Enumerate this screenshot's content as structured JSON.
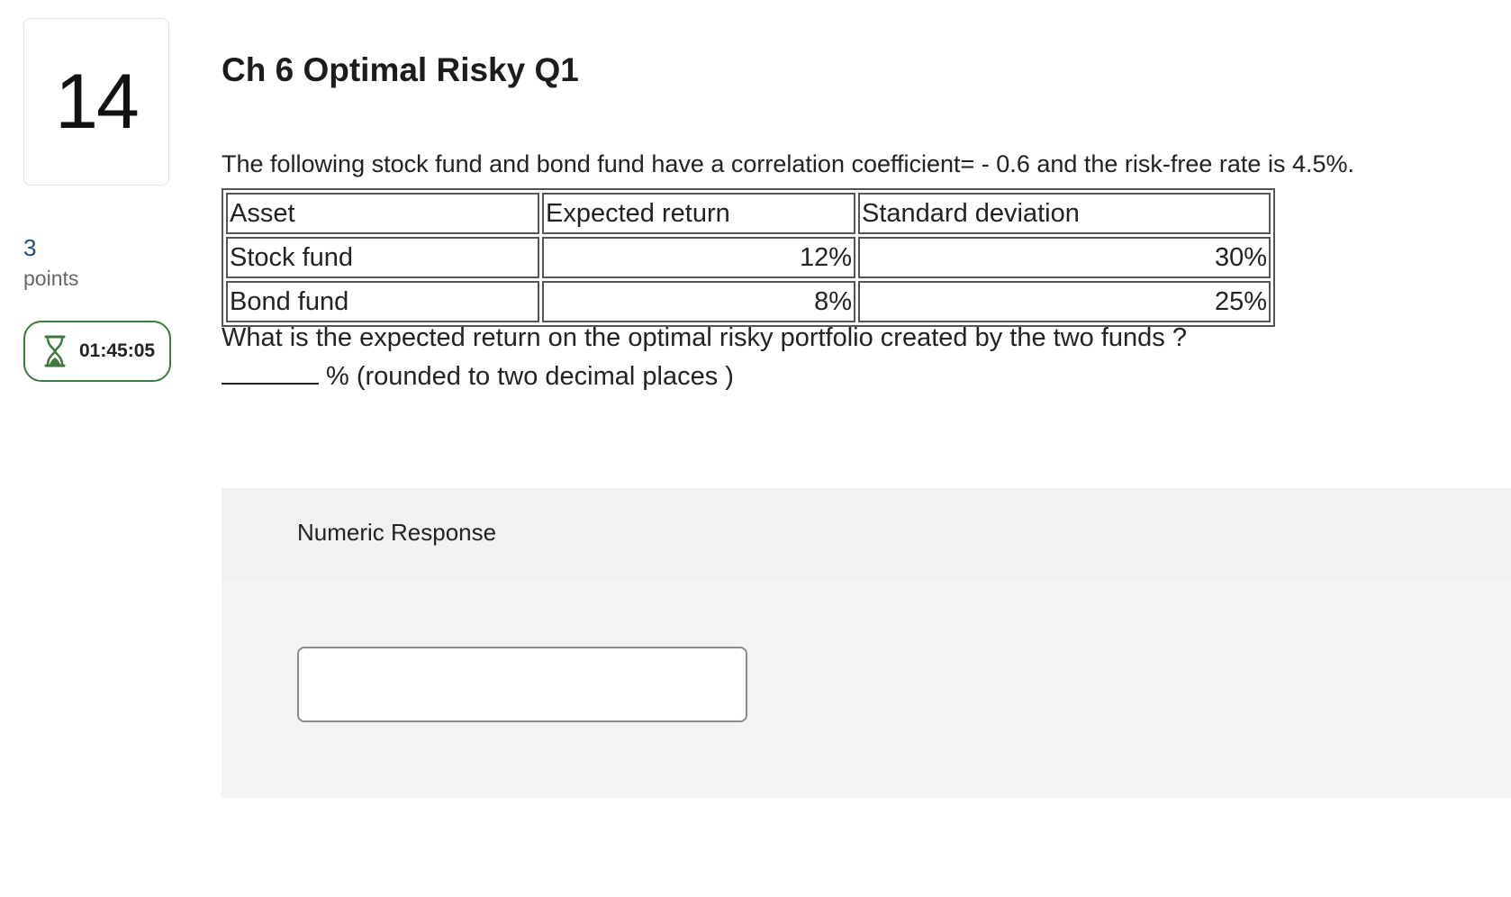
{
  "question": {
    "number": "14",
    "points_value": "3",
    "points_label": "points",
    "timer": "01:45:05",
    "title": "Ch 6 Optimal Risky Q1",
    "intro": "The following stock fund and bond fund have a correlation coefficient= - 0.6  and the risk-free rate is 4.5%.",
    "table": {
      "headers": [
        "Asset",
        "Expected return",
        "Standard deviation"
      ],
      "rows": [
        [
          "Stock fund",
          "12%",
          "30%"
        ],
        [
          "Bond fund",
          "8%",
          "25%"
        ]
      ]
    },
    "prompt": "What is the expected return on the optimal risky portfolio created by the two funds ?",
    "blank_suffix": "% (rounded to two decimal places )"
  },
  "response": {
    "title": "Numeric Response",
    "input_value": ""
  },
  "colors": {
    "points_value": "#1f4e79",
    "timer_border": "#3b7a3b",
    "panel_background": "#f3f3f3"
  },
  "icons": {
    "timer": "hourglass-icon"
  }
}
